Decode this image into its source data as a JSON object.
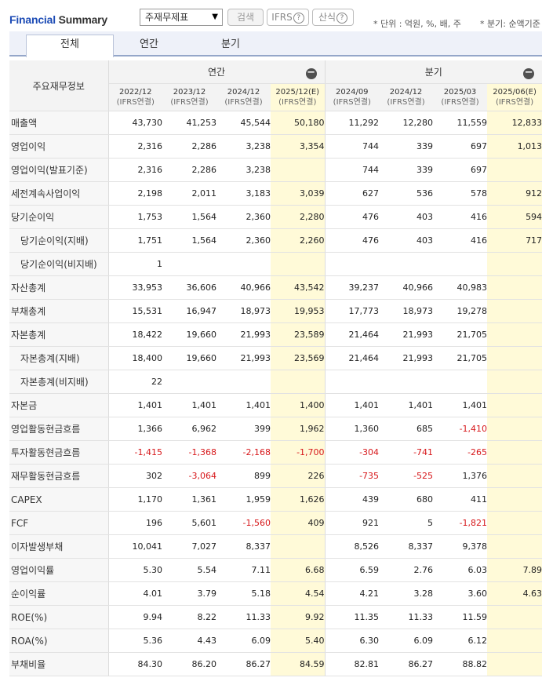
{
  "header": {
    "brand_part1": "Financial",
    "brand_part2": "Summary",
    "select_value": "주재무제표",
    "search_button": "검색",
    "ifrs_button": "IFRS",
    "sansik_button": "산식",
    "help_glyph": "?",
    "unit_note": "* 단위 : 억원, %, 배, 주",
    "bungi_note": "* 분기: 순액기준"
  },
  "tabs": [
    "전체",
    "연간",
    "분기"
  ],
  "table": {
    "row_header_label": "주요재무정보",
    "groups": [
      "연간",
      "분기"
    ],
    "periods": [
      {
        "date": "2022/12",
        "basis": "(IFRS연결)",
        "estimate": false
      },
      {
        "date": "2023/12",
        "basis": "(IFRS연결)",
        "estimate": false
      },
      {
        "date": "2024/12",
        "basis": "(IFRS연결)",
        "estimate": false
      },
      {
        "date": "2025/12(E)",
        "basis": "(IFRS연결)",
        "estimate": true
      },
      {
        "date": "2024/09",
        "basis": "(IFRS연결)",
        "estimate": false
      },
      {
        "date": "2024/12",
        "basis": "(IFRS연결)",
        "estimate": false
      },
      {
        "date": "2025/03",
        "basis": "(IFRS연결)",
        "estimate": false
      },
      {
        "date": "2025/06(E)",
        "basis": "(IFRS연결)",
        "estimate": true
      }
    ],
    "rows": [
      {
        "label": "매출액",
        "indent": false,
        "values": [
          "43,730",
          "41,253",
          "45,544",
          "50,180",
          "11,292",
          "12,280",
          "11,559",
          "12,833"
        ]
      },
      {
        "label": "영업이익",
        "indent": false,
        "values": [
          "2,316",
          "2,286",
          "3,238",
          "3,354",
          "744",
          "339",
          "697",
          "1,013"
        ]
      },
      {
        "label": "영업이익(발표기준)",
        "indent": false,
        "values": [
          "2,316",
          "2,286",
          "3,238",
          "",
          "744",
          "339",
          "697",
          ""
        ]
      },
      {
        "label": "세전계속사업이익",
        "indent": false,
        "values": [
          "2,198",
          "2,011",
          "3,183",
          "3,039",
          "627",
          "536",
          "578",
          "912"
        ]
      },
      {
        "label": "당기순이익",
        "indent": false,
        "values": [
          "1,753",
          "1,564",
          "2,360",
          "2,280",
          "476",
          "403",
          "416",
          "594"
        ]
      },
      {
        "label": "당기순이익(지배)",
        "indent": true,
        "values": [
          "1,751",
          "1,564",
          "2,360",
          "2,260",
          "476",
          "403",
          "416",
          "717"
        ]
      },
      {
        "label": "당기순이익(비지배)",
        "indent": true,
        "values": [
          "1",
          "",
          "",
          "",
          "",
          "",
          "",
          ""
        ]
      },
      {
        "label": "자산총계",
        "indent": false,
        "values": [
          "33,953",
          "36,606",
          "40,966",
          "43,542",
          "39,237",
          "40,966",
          "40,983",
          ""
        ]
      },
      {
        "label": "부채총계",
        "indent": false,
        "values": [
          "15,531",
          "16,947",
          "18,973",
          "19,953",
          "17,773",
          "18,973",
          "19,278",
          ""
        ]
      },
      {
        "label": "자본총계",
        "indent": false,
        "values": [
          "18,422",
          "19,660",
          "21,993",
          "23,589",
          "21,464",
          "21,993",
          "21,705",
          ""
        ]
      },
      {
        "label": "자본총계(지배)",
        "indent": true,
        "values": [
          "18,400",
          "19,660",
          "21,993",
          "23,569",
          "21,464",
          "21,993",
          "21,705",
          ""
        ]
      },
      {
        "label": "자본총계(비지배)",
        "indent": true,
        "values": [
          "22",
          "",
          "",
          "",
          "",
          "",
          "",
          ""
        ]
      },
      {
        "label": "자본금",
        "indent": false,
        "values": [
          "1,401",
          "1,401",
          "1,401",
          "1,400",
          "1,401",
          "1,401",
          "1,401",
          ""
        ]
      },
      {
        "label": "영업활동현금흐름",
        "indent": false,
        "values": [
          "1,366",
          "6,962",
          "399",
          "1,962",
          "1,360",
          "685",
          "-1,410",
          ""
        ]
      },
      {
        "label": "투자활동현금흐름",
        "indent": false,
        "values": [
          "-1,415",
          "-1,368",
          "-2,168",
          "-1,700",
          "-304",
          "-741",
          "-265",
          ""
        ]
      },
      {
        "label": "재무활동현금흐름",
        "indent": false,
        "values": [
          "302",
          "-3,064",
          "899",
          "226",
          "-735",
          "-525",
          "1,376",
          ""
        ]
      },
      {
        "label": "CAPEX",
        "indent": false,
        "values": [
          "1,170",
          "1,361",
          "1,959",
          "1,626",
          "439",
          "680",
          "411",
          ""
        ]
      },
      {
        "label": "FCF",
        "indent": false,
        "values": [
          "196",
          "5,601",
          "-1,560",
          "409",
          "921",
          "5",
          "-1,821",
          ""
        ]
      },
      {
        "label": "이자발생부채",
        "indent": false,
        "values": [
          "10,041",
          "7,027",
          "8,337",
          "",
          "8,526",
          "8,337",
          "9,378",
          ""
        ]
      },
      {
        "label": "영업이익률",
        "indent": false,
        "values": [
          "5.30",
          "5.54",
          "7.11",
          "6.68",
          "6.59",
          "2.76",
          "6.03",
          "7.89"
        ]
      },
      {
        "label": "순이익률",
        "indent": false,
        "values": [
          "4.01",
          "3.79",
          "5.18",
          "4.54",
          "4.21",
          "3.28",
          "3.60",
          "4.63"
        ]
      },
      {
        "label": "ROE(%)",
        "indent": false,
        "values": [
          "9.94",
          "8.22",
          "11.33",
          "9.92",
          "11.35",
          "11.33",
          "11.59",
          ""
        ]
      },
      {
        "label": "ROA(%)",
        "indent": false,
        "values": [
          "5.36",
          "4.43",
          "6.09",
          "5.40",
          "6.30",
          "6.09",
          "6.12",
          ""
        ]
      },
      {
        "label": "부채비율",
        "indent": false,
        "values": [
          "84.30",
          "86.20",
          "86.27",
          "84.59",
          "82.81",
          "86.27",
          "88.82",
          ""
        ]
      }
    ]
  }
}
